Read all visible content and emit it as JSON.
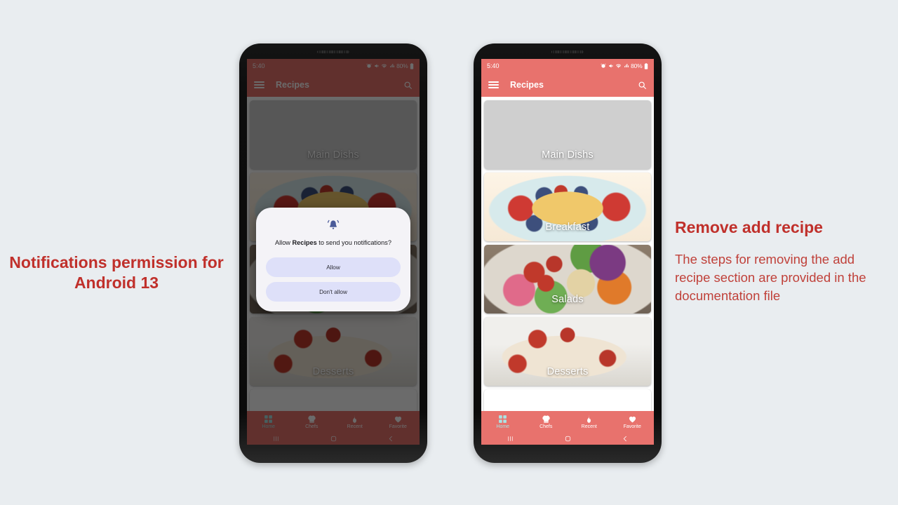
{
  "canvas": {
    "background": "#e9edf0"
  },
  "annotations": {
    "left": {
      "title": "Notifications permission for Android 13",
      "color": "#c0302b"
    },
    "right": {
      "title": "Remove add recipe",
      "body": "The steps for removing the add recipe section are provided in the documentation file",
      "color": "#c0302b"
    }
  },
  "phones": [
    {
      "id": "phone-left",
      "status_bar": {
        "time": "5:40",
        "battery_text": "80%",
        "icons": [
          "alarm-icon",
          "mute-icon",
          "wifi-icon",
          "signal-icon",
          "battery-icon"
        ]
      },
      "app_bar": {
        "menu_icon": "hamburger-icon",
        "title": "Recipes",
        "search_icon": "search-icon",
        "color": "#e8726d"
      },
      "cards": [
        {
          "label": "Main Dishs",
          "image": "img-pasta"
        },
        {
          "label": "Breakfast",
          "image": "img-breakfast"
        },
        {
          "label": "Salads",
          "image": "img-salad"
        },
        {
          "label": "Desserts",
          "image": "img-dessert"
        }
      ],
      "bottom_nav": {
        "color": "#e8726d",
        "active_color": "#a9e4e4",
        "items": [
          {
            "label": "Home",
            "icon": "grid-icon",
            "active": true
          },
          {
            "label": "Chefs",
            "icon": "chef-hat-icon",
            "active": false
          },
          {
            "label": "Recent",
            "icon": "flame-icon",
            "active": false
          },
          {
            "label": "Favorite",
            "icon": "heart-icon",
            "active": false
          }
        ]
      },
      "system_keys": [
        "recents-key",
        "home-key",
        "back-key"
      ],
      "dialog": {
        "visible": true,
        "icon": "bell-icon",
        "message_before": "Allow ",
        "message_bold": "Recipes",
        "message_after": " to send you notifications?",
        "buttons": [
          {
            "label": "Allow"
          },
          {
            "label": "Don't allow"
          }
        ],
        "button_color": "#dee0f9"
      }
    },
    {
      "id": "phone-right",
      "status_bar": {
        "time": "5:40",
        "battery_text": "80%",
        "icons": [
          "alarm-icon",
          "mute-icon",
          "wifi-icon",
          "signal-icon",
          "battery-icon"
        ]
      },
      "app_bar": {
        "menu_icon": "hamburger-icon",
        "title": "Recipes",
        "search_icon": "search-icon",
        "color": "#e8726d"
      },
      "cards": [
        {
          "label": "Main Dishs",
          "image": "img-pasta"
        },
        {
          "label": "Breakfast",
          "image": "img-breakfast"
        },
        {
          "label": "Salads",
          "image": "img-salad"
        },
        {
          "label": "Desserts",
          "image": "img-dessert"
        }
      ],
      "bottom_nav": {
        "color": "#e8726d",
        "active_color": "#a9e4e4",
        "items": [
          {
            "label": "Home",
            "icon": "grid-icon",
            "active": true
          },
          {
            "label": "Chefs",
            "icon": "chef-hat-icon",
            "active": false
          },
          {
            "label": "Recent",
            "icon": "flame-icon",
            "active": false
          },
          {
            "label": "Favorite",
            "icon": "heart-icon",
            "active": false
          }
        ]
      },
      "system_keys": [
        "recents-key",
        "home-key",
        "back-key"
      ],
      "dialog": {
        "visible": false
      }
    }
  ]
}
